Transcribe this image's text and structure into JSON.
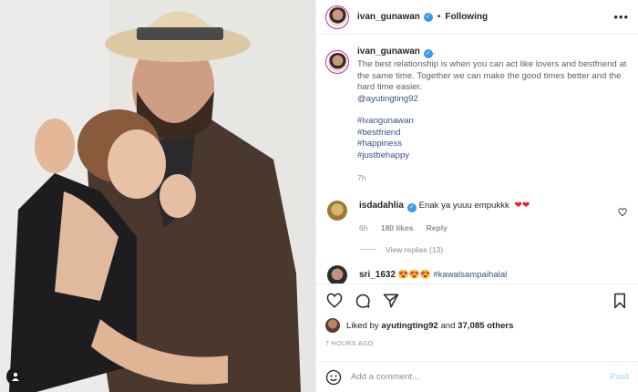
{
  "post": {
    "author": "ivan_gunawan",
    "follow_status": "Following",
    "dot": "•",
    "more": "•••"
  },
  "caption": {
    "author": "ivan_gunawan",
    "period": ".",
    "text": "The best relationship is when you can act like lovers and bestfriend at the same time. Together we can make the good times better and the hard time easier.",
    "mention": "@ayutingting92",
    "hashtags": [
      "#ivangunawan",
      "#bestfriend",
      "#happiness",
      "#justbehappy"
    ],
    "time": "7h"
  },
  "comments": [
    {
      "author": "isdadahlia",
      "text": "Enak ya yuuu empukkk",
      "emoji": "❤❤",
      "time": "6h",
      "likes": "180 likes",
      "reply_label": "Reply",
      "view_replies": "View replies (13)"
    },
    {
      "author": "sri_1632",
      "emoji": "😍😍😍",
      "text": "#kawalsampaihalal"
    }
  ],
  "likes": {
    "prefix": "Liked by",
    "user": "ayutingting92",
    "conj": "and",
    "others": "37,085 others"
  },
  "time_ago": "7 HOURS AGO",
  "add_comment": {
    "placeholder": "Add a comment...",
    "post_label": "Post"
  },
  "colors": {
    "link": "#385185",
    "verified": "#3897f0",
    "heart": "#ed1c24",
    "post_disabled": "#b2dffc"
  },
  "icons": [
    "user-tag-icon",
    "verified-icon",
    "heart-icon",
    "comment-icon",
    "share-icon",
    "bookmark-icon",
    "smile-icon"
  ]
}
